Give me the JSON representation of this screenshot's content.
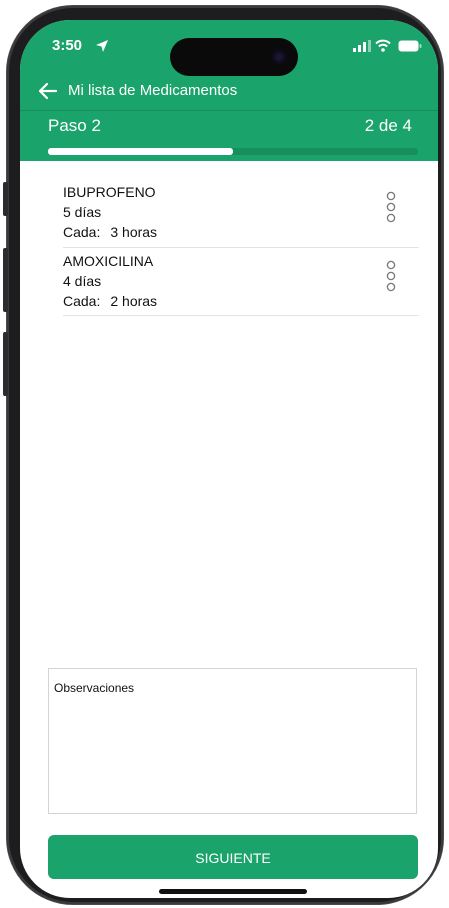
{
  "status_bar": {
    "time": "3:50"
  },
  "nav": {
    "title": "Mi lista de Medicamentos"
  },
  "step": {
    "label": "Paso 2",
    "count": "2 de 4",
    "progress": 0.5
  },
  "medications": [
    {
      "name": "IBUPROFENO",
      "duration": "5 días",
      "every_label": "Cada:",
      "every_value": "3 horas"
    },
    {
      "name": "AMOXICILINA",
      "duration": "4 días",
      "every_label": "Cada:",
      "every_value": "2 horas"
    }
  ],
  "observations": {
    "label": "Observaciones"
  },
  "actions": {
    "next_label": "SIGUIENTE"
  },
  "colors": {
    "brand_green": "#1aa36a",
    "progress_fill": "#ffffff"
  }
}
